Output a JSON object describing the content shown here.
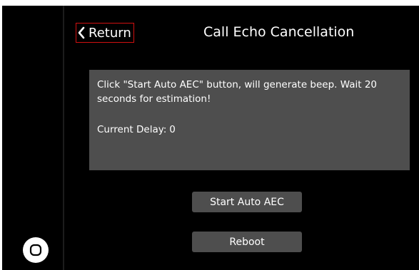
{
  "header": {
    "return_label": "Return",
    "title": "Call Echo Cancellation"
  },
  "info_panel": {
    "message": "Click \"Start Auto AEC\" button, will generate beep. Wait 20 seconds for estimation!",
    "delay_label": "Current Delay:",
    "delay_value": "0"
  },
  "buttons": {
    "start_label": "Start Auto AEC",
    "reboot_label": "Reboot"
  },
  "colors": {
    "background": "#000000",
    "panel": "#4e4e4e",
    "text": "#ffffff",
    "return_outline": "#d01010"
  },
  "icons": {
    "return": "chevron-left-icon",
    "home": "home-circle-icon"
  }
}
